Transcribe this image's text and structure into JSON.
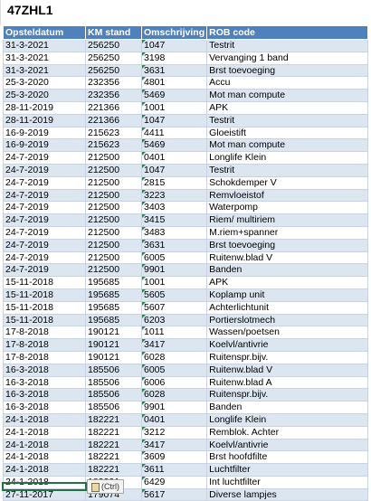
{
  "sheet": {
    "title": "47ZHL1",
    "headers": [
      "Opsteldatum",
      "KM stand",
      "Omschrijving",
      "ROB code"
    ],
    "rows": [
      [
        "31-3-2021",
        "256250",
        "1047",
        "Testrit"
      ],
      [
        "31-3-2021",
        "256250",
        "3198",
        "Vervanging 1 band"
      ],
      [
        "31-3-2021",
        "256250",
        "3631",
        "Brst toevoeging"
      ],
      [
        "25-3-2020",
        "232356",
        "4801",
        "Accu"
      ],
      [
        "25-3-2020",
        "232356",
        "5469",
        "Mot man compute"
      ],
      [
        "28-11-2019",
        "221366",
        "1001",
        "APK"
      ],
      [
        "28-11-2019",
        "221366",
        "1047",
        "Testrit"
      ],
      [
        "16-9-2019",
        "215623",
        "4411",
        "Gloeistift"
      ],
      [
        "16-9-2019",
        "215623",
        "5469",
        "Mot man compute"
      ],
      [
        "24-7-2019",
        "212500",
        "0401",
        "Longlife Klein"
      ],
      [
        "24-7-2019",
        "212500",
        "1047",
        "Testrit"
      ],
      [
        "24-7-2019",
        "212500",
        "2815",
        "Schokdemper V"
      ],
      [
        "24-7-2019",
        "212500",
        "3223",
        "Remvloeistof"
      ],
      [
        "24-7-2019",
        "212500",
        "3403",
        "Waterpomp"
      ],
      [
        "24-7-2019",
        "212500",
        "3415",
        "Riem/ multiriem"
      ],
      [
        "24-7-2019",
        "212500",
        "3483",
        "M.riem+spanner"
      ],
      [
        "24-7-2019",
        "212500",
        "3631",
        "Brst toevoeging"
      ],
      [
        "24-7-2019",
        "212500",
        "6005",
        "Ruitenw.blad V"
      ],
      [
        "24-7-2019",
        "212500",
        "9901",
        "Banden"
      ],
      [
        "15-11-2018",
        "195685",
        "1001",
        "APK"
      ],
      [
        "15-11-2018",
        "195685",
        "5605",
        "Koplamp unit"
      ],
      [
        "15-11-2018",
        "195685",
        "5607",
        "Achterlichtunit"
      ],
      [
        "15-11-2018",
        "195685",
        "6203",
        "Portierslotmech"
      ],
      [
        "17-8-2018",
        "190121",
        "1011",
        "Wassen/poetsen"
      ],
      [
        "17-8-2018",
        "190121",
        "3417",
        "Koelvl/antivrie"
      ],
      [
        "17-8-2018",
        "190121",
        "6028",
        "Ruitenspr.bijv."
      ],
      [
        "16-3-2018",
        "185506",
        "6005",
        "Ruitenw.blad V"
      ],
      [
        "16-3-2018",
        "185506",
        "6006",
        "Ruitenw.blad A"
      ],
      [
        "16-3-2018",
        "185506",
        "6028",
        "Ruitenspr.bijv."
      ],
      [
        "16-3-2018",
        "185506",
        "9901",
        "Banden"
      ],
      [
        "24-1-2018",
        "182221",
        "0401",
        "Longlife Klein"
      ],
      [
        "24-1-2018",
        "182221",
        "3212",
        "Remblok. Achter"
      ],
      [
        "24-1-2018",
        "182221",
        "3417",
        "Koelvl/antivrie"
      ],
      [
        "24-1-2018",
        "182221",
        "3609",
        "Brst hoofdfilte"
      ],
      [
        "24-1-2018",
        "182221",
        "3611",
        "Luchtfilter"
      ],
      [
        "24-1-2018",
        "182221",
        "6429",
        "Int luchtfilter"
      ],
      [
        "27-11-2017",
        "179074",
        "5617",
        "Diverse lampjes"
      ]
    ],
    "paste_options_label": "(Ctrl)"
  }
}
